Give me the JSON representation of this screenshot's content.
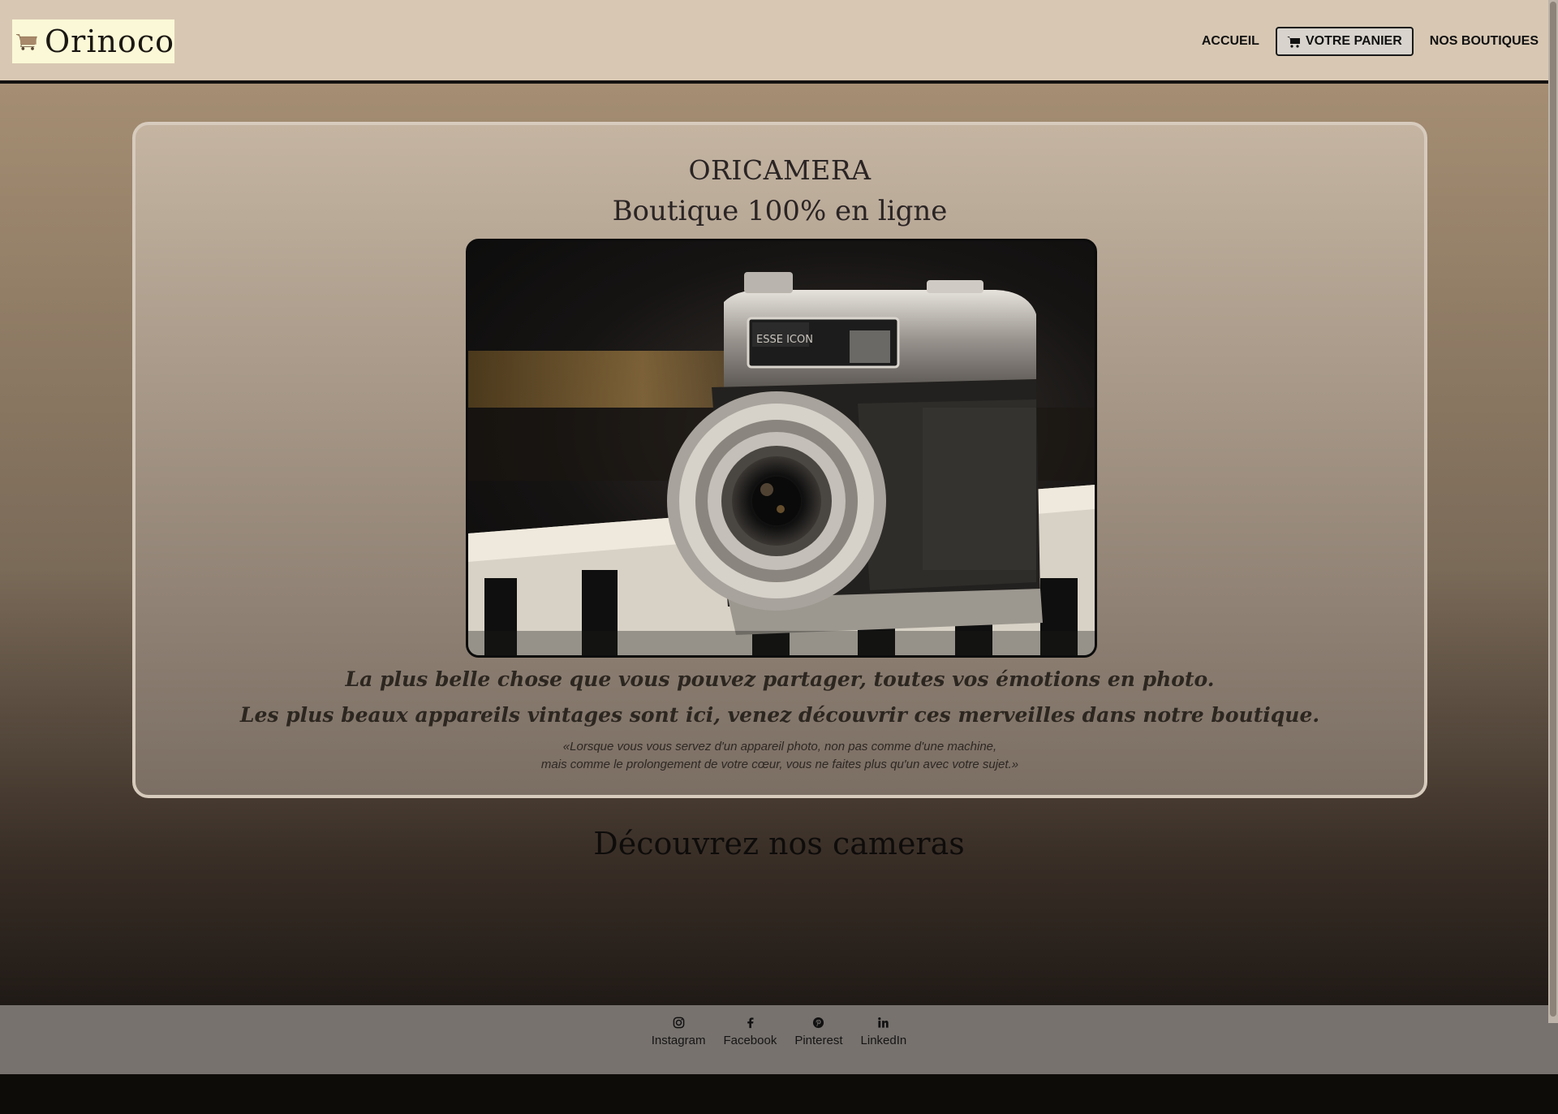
{
  "header": {
    "logo_text": "Orinoco",
    "nav": {
      "home": "ACCUEIL",
      "cart": "VOTRE PANIER",
      "shops": "NOS BOUTIQUES"
    }
  },
  "hero": {
    "title_line1": "ORICAMERA",
    "title_line2": "Boutique 100% en ligne",
    "tagline_line1": "La plus belle chose que vous pouvez partager, toutes vos émotions en photo.",
    "tagline_line2": "Les plus beaux appareils vintages sont ici, venez découvrir ces merveilles dans notre boutique.",
    "quote_line1": "«Lorsque vous vous servez d'un appareil photo, non pas comme d'une machine,",
    "quote_line2": "mais comme le prolongement de votre cœur, vous ne faites plus qu'un avec votre sujet.»",
    "camera_label": "ESSE ICON"
  },
  "section": {
    "title": "Découvrez nos cameras"
  },
  "footer": {
    "links": [
      {
        "label": "Instagram",
        "icon": "instagram-icon"
      },
      {
        "label": "Facebook",
        "icon": "facebook-icon"
      },
      {
        "label": "Pinterest",
        "icon": "pinterest-icon"
      },
      {
        "label": "LinkedIn",
        "icon": "linkedin-icon"
      }
    ]
  },
  "colors": {
    "header_bg": "#d8c8b3",
    "logo_bg": "#fbf8d7",
    "footer_bg": "#77726e",
    "text_dark": "#2a2424"
  }
}
